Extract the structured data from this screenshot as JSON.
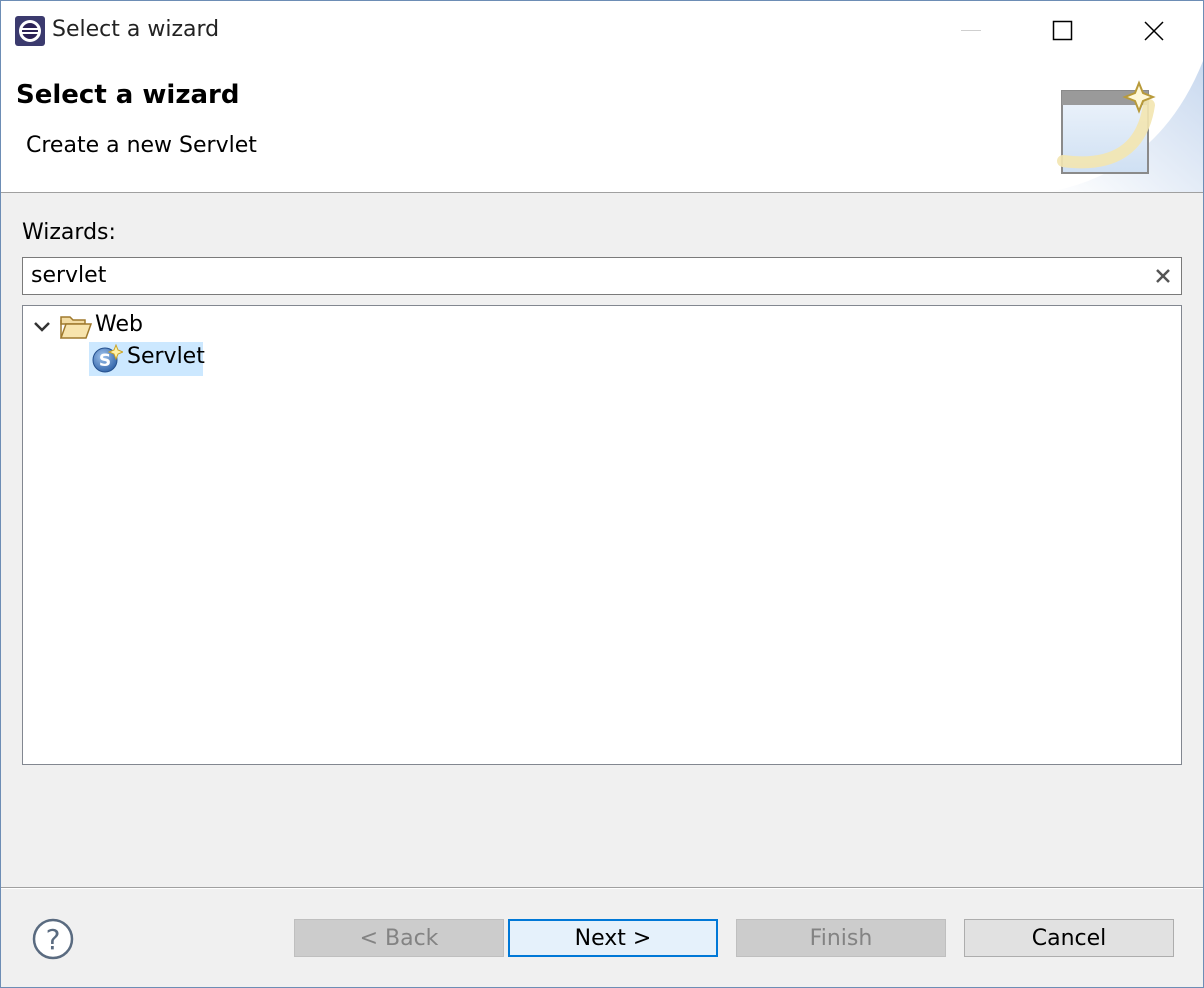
{
  "window": {
    "title": "Select a wizard"
  },
  "header": {
    "title": "Select a wizard",
    "description": "Create a new Servlet"
  },
  "wizards": {
    "label": "Wizards:",
    "filter_value": "servlet"
  },
  "tree": {
    "items": [
      {
        "label": "Web",
        "expanded": true,
        "icon": "folder-open-icon"
      },
      {
        "label": "Servlet",
        "selected": true,
        "icon": "servlet-icon"
      }
    ]
  },
  "buttons": {
    "back": "< Back",
    "next": "Next >",
    "finish": "Finish",
    "cancel": "Cancel"
  },
  "colors": {
    "selection": "#cce8ff",
    "default_button_border": "#0078d7"
  }
}
